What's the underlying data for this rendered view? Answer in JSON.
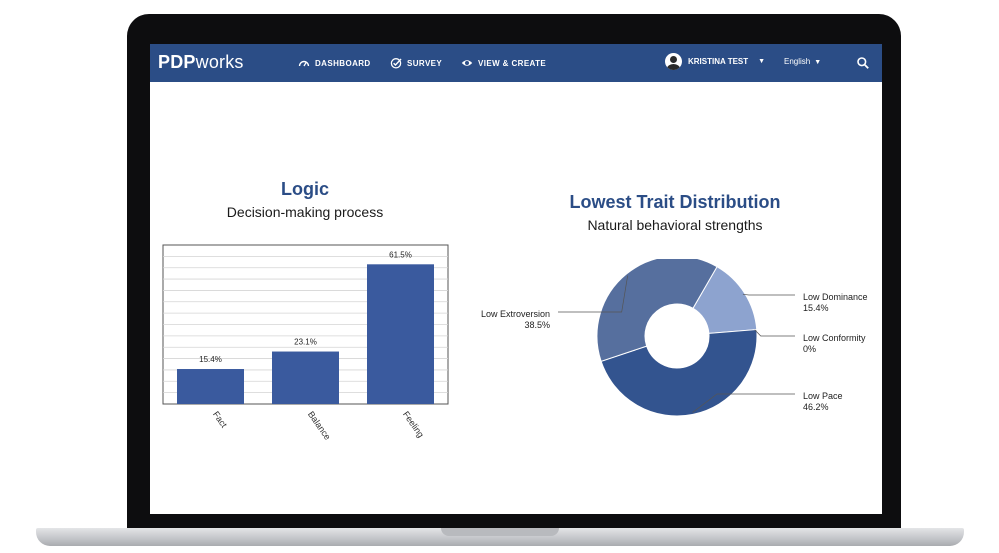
{
  "nav": {
    "logo_bold": "PDP",
    "logo_light": "works",
    "items": [
      {
        "label": "DASHBOARD",
        "icon": "gauge-icon"
      },
      {
        "label": "SURVEY",
        "icon": "check-circle-icon"
      },
      {
        "label": "VIEW & CREATE",
        "icon": "eye-icon"
      }
    ],
    "user_name": "KRISTINA TEST",
    "language": "English",
    "search_icon": "search-icon",
    "bar_color": "#2b4d86"
  },
  "logic_panel": {
    "title": "Logic",
    "subtitle": "Decision-making process"
  },
  "trait_panel": {
    "title": "Lowest Trait Distribution",
    "subtitle": "Natural behavioral strengths"
  },
  "chart_data": [
    {
      "type": "bar",
      "title": "Logic",
      "subtitle": "Decision-making process",
      "categories": [
        "Fact",
        "Balance",
        "Feeling"
      ],
      "values": [
        15.4,
        23.1,
        61.5
      ],
      "value_labels": [
        "15.4%",
        "23.1%",
        "61.5%"
      ],
      "ylim": [
        0,
        70
      ],
      "grid": true,
      "color": "#3a5a9e"
    },
    {
      "type": "pie",
      "donut": true,
      "title": "Lowest Trait Distribution",
      "subtitle": "Natural behavioral strengths",
      "slices": [
        {
          "label": "Low Dominance",
          "value": 15.4,
          "value_label": "15.4%",
          "color": "#8da3cf"
        },
        {
          "label": "Low Conformity",
          "value": 0,
          "value_label": "0%",
          "color": "#6f89bd"
        },
        {
          "label": "Low Pace",
          "value": 46.2,
          "value_label": "46.2%",
          "color": "#33548f"
        },
        {
          "label": "Low Extroversion",
          "value": 38.5,
          "value_label": "38.5%",
          "color": "#566f9e"
        }
      ]
    }
  ]
}
